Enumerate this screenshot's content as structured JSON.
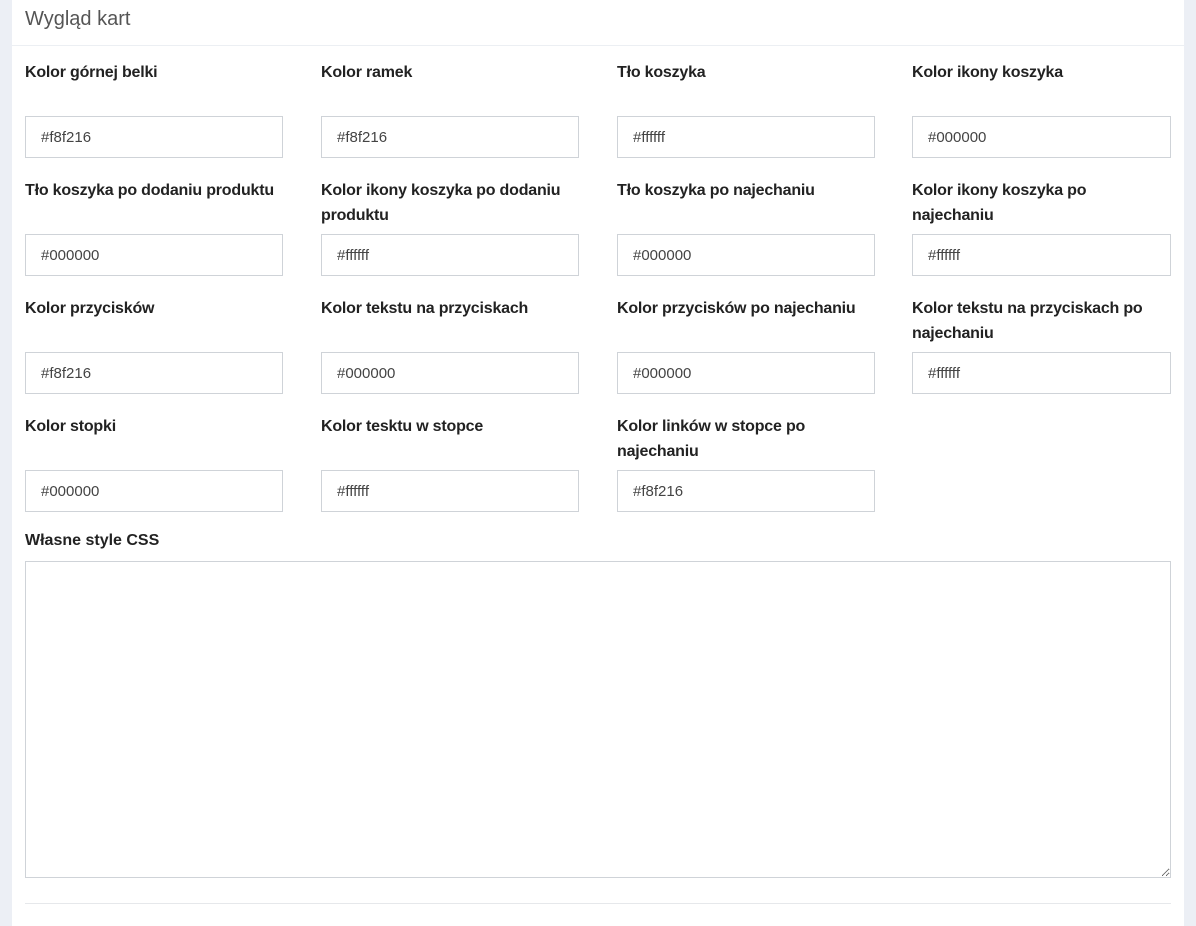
{
  "panel": {
    "title": "Wygląd kart"
  },
  "rows": [
    [
      {
        "label": "Kolor górnej belki",
        "value": "#f8f216"
      },
      {
        "label": "Kolor ramek",
        "value": "#f8f216"
      },
      {
        "label": "Tło koszyka",
        "value": "#ffffff"
      },
      {
        "label": "Kolor ikony koszyka",
        "value": "#000000"
      }
    ],
    [
      {
        "label": "Tło koszyka po dodaniu produktu",
        "value": "#000000"
      },
      {
        "label": "Kolor ikony koszyka po dodaniu produktu",
        "value": "#ffffff"
      },
      {
        "label": "Tło koszyka po najechaniu",
        "value": "#000000"
      },
      {
        "label": "Kolor ikony koszyka po najechaniu",
        "value": "#ffffff"
      }
    ],
    [
      {
        "label": "Kolor przycisków",
        "value": "#f8f216"
      },
      {
        "label": "Kolor tekstu na przyciskach",
        "value": "#000000"
      },
      {
        "label": "Kolor przycisków po najechaniu",
        "value": "#000000"
      },
      {
        "label": "Kolor tekstu na przyciskach po najechaniu",
        "value": "#ffffff"
      }
    ],
    [
      {
        "label": "Kolor stopki",
        "value": "#000000"
      },
      {
        "label": "Kolor tesktu w stopce",
        "value": "#ffffff"
      },
      {
        "label": "Kolor linków w stopce po najechaniu",
        "value": "#f8f216"
      }
    ]
  ],
  "custom_css": {
    "label": "Własne style CSS",
    "value": ""
  }
}
